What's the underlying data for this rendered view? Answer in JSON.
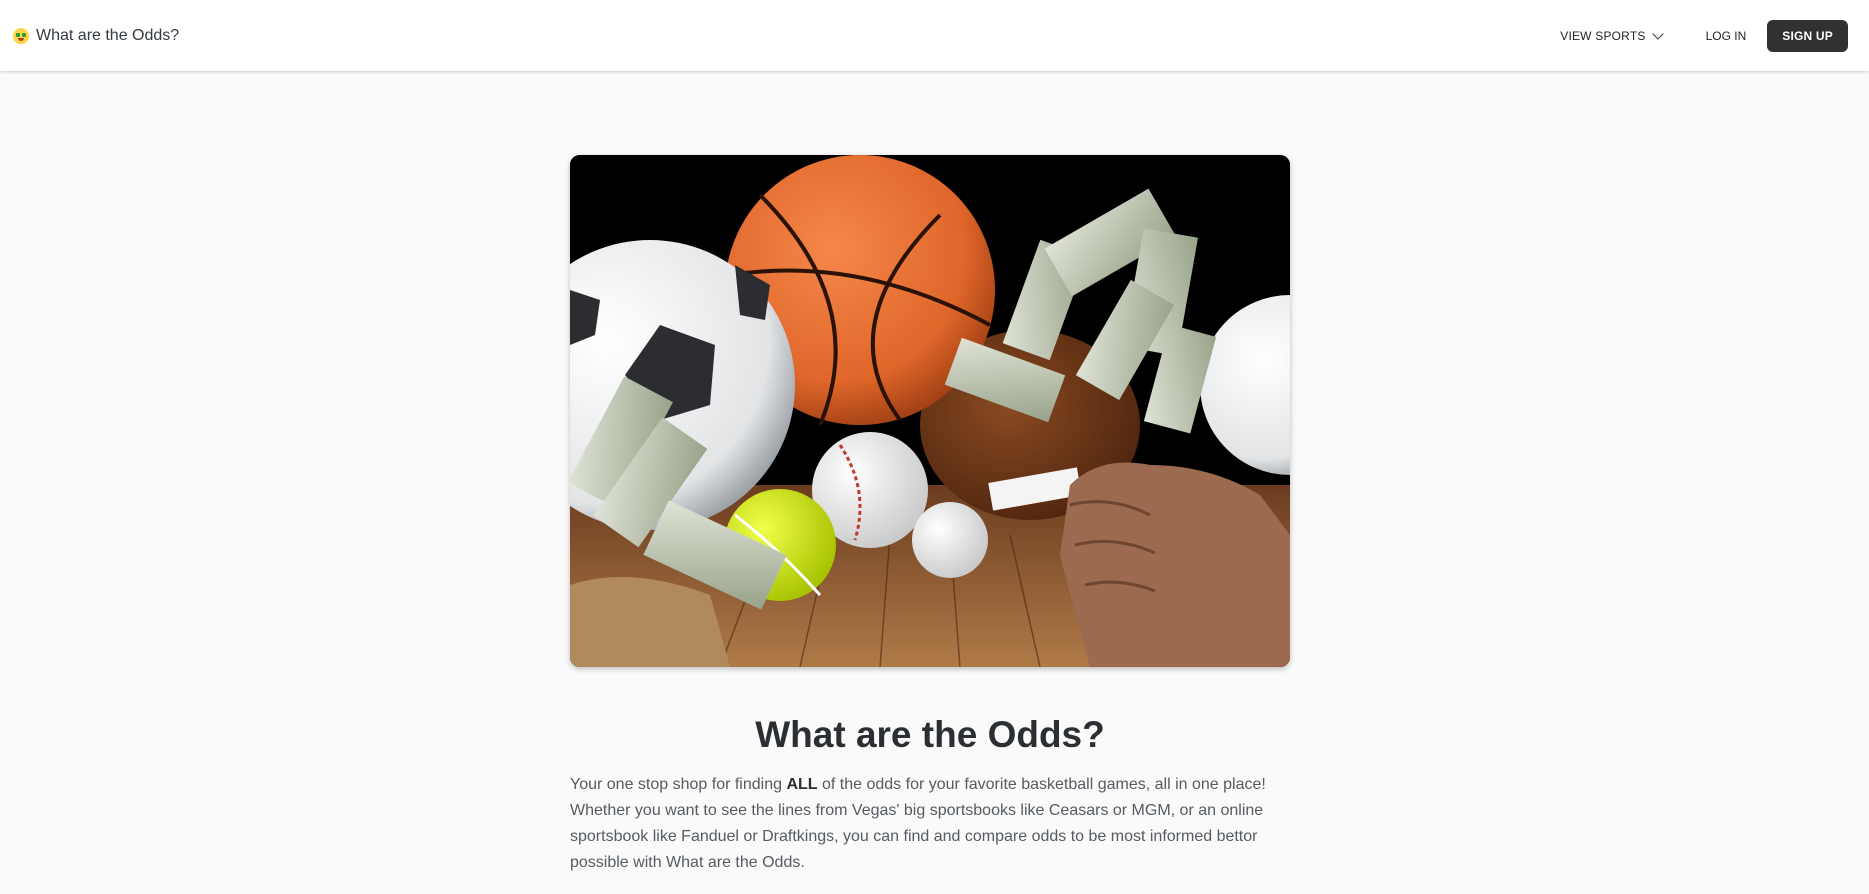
{
  "header": {
    "brand_icon": "money-mouth-face-icon",
    "brand_title": "What are the Odds?",
    "nav": {
      "view_sports": "VIEW SPORTS",
      "log_in": "LOG IN",
      "sign_up": "SIGN UP"
    }
  },
  "hero": {
    "image": "sports-balls-and-cash-photo"
  },
  "main": {
    "title": "What are the Odds?",
    "description": {
      "part1": "Your one stop shop for finding ",
      "emphasis": "ALL",
      "part2": " of the odds for your favorite basketball games, all in one place! Whether you want to see the lines from Vegas' big sportsbooks like Ceasars or MGM, or an online sportsbook like Fanduel or Draftkings, you can find and compare odds to be most informed bettor possible with What are the Odds."
    }
  },
  "colors": {
    "header_bg": "#ffffff",
    "page_bg": "#fafafa",
    "signup_bg": "#2f3133",
    "title_color": "#2b2f33",
    "text_color": "#555b61"
  }
}
